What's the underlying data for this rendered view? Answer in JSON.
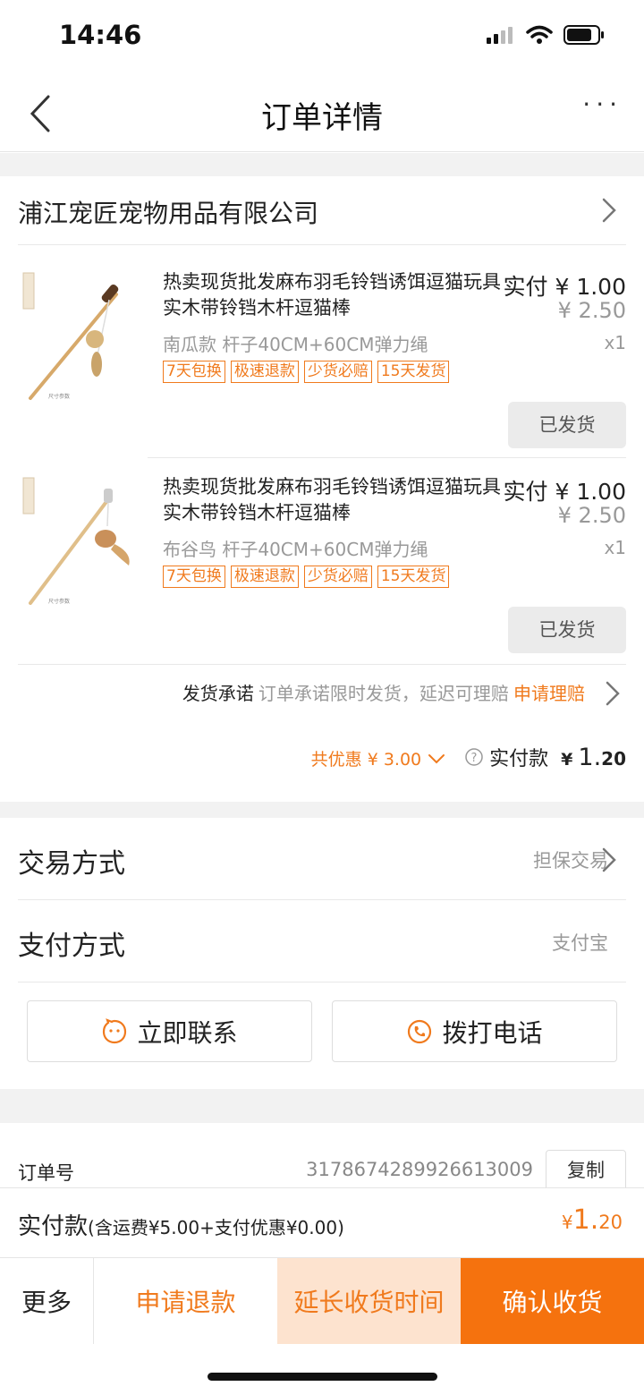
{
  "status": {
    "time": "14:46"
  },
  "nav": {
    "title": "订单详情",
    "more": "···"
  },
  "shop": {
    "name": "浦江宠匠宠物用品有限公司"
  },
  "items": [
    {
      "title": "热卖现货批发麻布羽毛铃铛诱饵逗猫玩具 实木带铃铛木杆逗猫棒",
      "price_label": "实付",
      "price": "¥ 1.00",
      "orig_price": "¥ 2.50",
      "sku": "南瓜款 杆子40CM+60CM弹力绳",
      "qty": "x1",
      "tags": [
        "7天包换",
        "极速退款",
        "少货必赔",
        "15天发货"
      ],
      "status_btn": "已发货"
    },
    {
      "title": "热卖现货批发麻布羽毛铃铛诱饵逗猫玩具 实木带铃铛木杆逗猫棒",
      "price_label": "实付",
      "price": "¥ 1.00",
      "orig_price": "¥ 2.50",
      "sku": "布谷鸟 杆子40CM+60CM弹力绳",
      "qty": "x1",
      "tags": [
        "7天包换",
        "极速退款",
        "少货必赔",
        "15天发货"
      ],
      "status_btn": "已发货"
    }
  ],
  "promise": {
    "label": "发货承诺",
    "text": "订单承诺限时发货，延迟可理赔",
    "link": "申请理赔"
  },
  "summary": {
    "discount": "共优惠 ¥ 3.00",
    "paid_label": "实付款",
    "currency": "¥",
    "amount_int": "1.",
    "amount_dec": "20"
  },
  "trade": {
    "label": "交易方式",
    "value": "担保交易"
  },
  "payment": {
    "label": "支付方式",
    "value": "支付宝"
  },
  "contact": {
    "chat": "立即联系",
    "call": "拨打电话"
  },
  "order": {
    "label": "订单号",
    "number": "3178674289926613009",
    "copy": "复制"
  },
  "paybar": {
    "label": "实付款",
    "detail": "(含运费¥5.00+支付优惠¥0.00)",
    "currency": "¥",
    "amount_int": "1.",
    "amount_dec": "20"
  },
  "actions": {
    "more": "更多",
    "refund": "申请退款",
    "extend": "延长收货时间",
    "confirm": "确认收货"
  },
  "colors": {
    "accent": "#f07a1d",
    "confirm_bg": "#f5720e",
    "extend_bg": "#fde3cf"
  }
}
